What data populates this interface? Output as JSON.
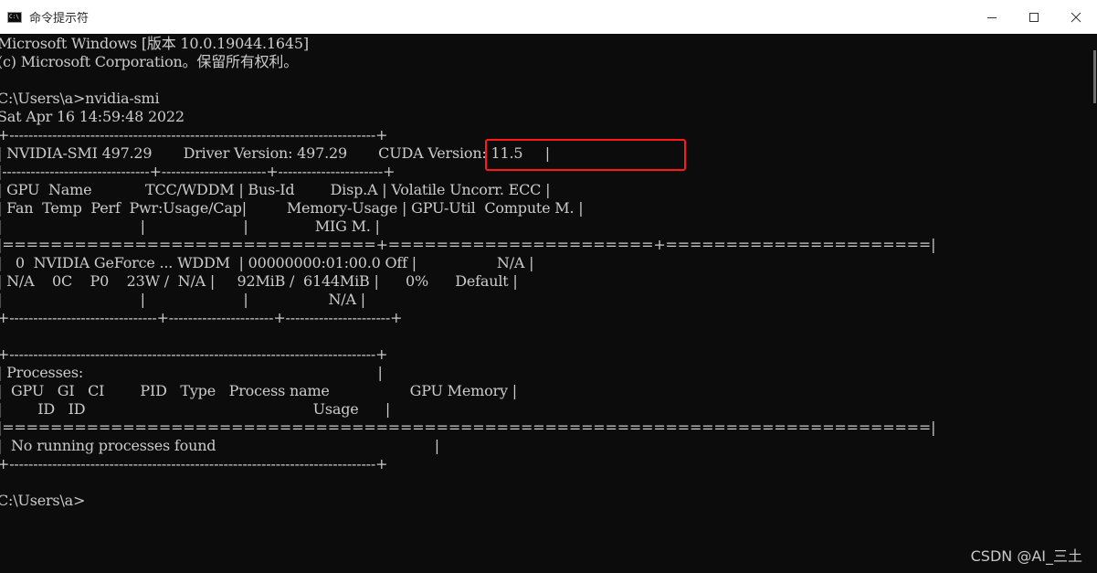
{
  "window": {
    "title": "命令提示符",
    "icon_glyph": "C:\\",
    "icon_name": "cmd-icon"
  },
  "console": {
    "lines": [
      "Microsoft Windows [版本 10.0.19044.1645]",
      "(c) Microsoft Corporation。保留所有权利。",
      "",
      "C:\\Users\\a>nvidia-smi",
      "Sat Apr 16 14:59:48 2022",
      "+-----------------------------------------------------------------------------+",
      "| NVIDIA-SMI 497.29       Driver Version: 497.29       CUDA Version: 11.5     |",
      "|-------------------------------+----------------------+----------------------+",
      "| GPU  Name            TCC/WDDM | Bus-Id        Disp.A | Volatile Uncorr. ECC |",
      "| Fan  Temp  Perf  Pwr:Usage/Cap|         Memory-Usage | GPU-Util  Compute M. |",
      "|                               |                      |               MIG M. |",
      "|===============================+======================+======================|",
      "|   0  NVIDIA GeForce ... WDDM  | 00000000:01:00.0 Off |                  N/A |",
      "| N/A    0C    P0    23W /  N/A |     92MiB /  6144MiB |      0%      Default |",
      "|                               |                      |                  N/A |",
      "+-------------------------------+----------------------+----------------------+",
      "",
      "+-----------------------------------------------------------------------------+",
      "| Processes:                                                                  |",
      "|  GPU   GI   CI        PID   Type   Process name                  GPU Memory |",
      "|        ID   ID                                                   Usage      |",
      "|=============================================================================|",
      "|  No running processes found                                                 |",
      "+-----------------------------------------------------------------------------+",
      "",
      "C:\\Users\\a>"
    ]
  },
  "highlight": {
    "label": "CUDA Version: 11.5",
    "color": "#ff1a1a"
  },
  "watermark": {
    "text": "CSDN @AI_三土"
  }
}
